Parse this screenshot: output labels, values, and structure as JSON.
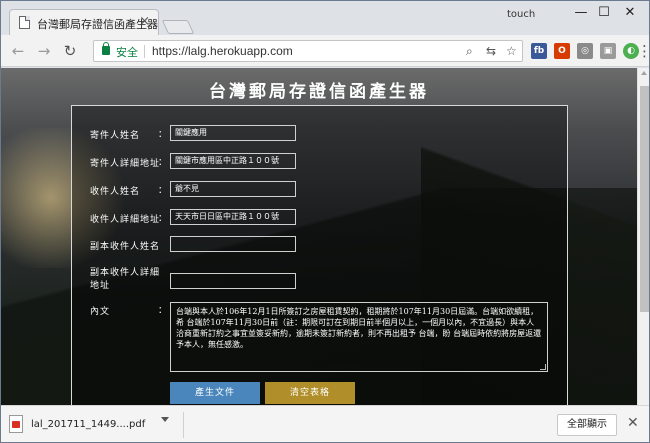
{
  "browser": {
    "tab_title": "台灣郵局存證信函產生器",
    "tab_close": "×",
    "profile_label": "touch",
    "window_controls": {
      "minimize": "—",
      "maximize": "☐",
      "close": "✕"
    },
    "nav": {
      "back": "←",
      "forward": "→",
      "reload": "↻"
    },
    "secure_label": "安全",
    "url": "https://lalg.herokuapp.com",
    "extensions": [
      {
        "name": "facebook",
        "label": "fb",
        "color": "#3b5998"
      },
      {
        "name": "office",
        "label": "O",
        "color": "#d83b01"
      },
      {
        "name": "capture",
        "label": "◎",
        "color": "#8a8a8a"
      },
      {
        "name": "screenshot",
        "label": "▣",
        "color": "#9a9a9a"
      },
      {
        "name": "chrome-ext",
        "label": "◐",
        "color": "#4caf50"
      }
    ],
    "menu": "⋮"
  },
  "page": {
    "title": "台灣郵局存證信函產生器",
    "fields": [
      {
        "label": "寄件人姓名",
        "value": "關鍵應用"
      },
      {
        "label": "寄件人詳細地址",
        "value": "關鍵市應用區中正路１００號"
      },
      {
        "label": "收件人姓名",
        "value": "爺不見"
      },
      {
        "label": "收件人詳細地址",
        "value": "天天市日日區中正路１００號"
      },
      {
        "label": "副本收件人姓名",
        "value": ""
      },
      {
        "label_line1": "副本收件人詳細",
        "label_line2": "地址",
        "value": ""
      }
    ],
    "content_label": "內文",
    "colon": "：",
    "content_text": "台端與本人於106年12月1日所簽訂之房屋租賃契約，租期將於107年11月30日屆滿。台端如欲續租，希 台端於107年11月30日前（註：期限可訂在到期日前半個月以上，一個月以內，不宜過長）與本人洽商重新訂約之事宜並簽妥新約，逾期未簽訂新約者，則不再出租予 台端，盼 台端屆時依約將房屋返還予本人，無任感激。",
    "generate_button": "產生文件",
    "clear_button": "清空表格"
  },
  "downloads": {
    "file_name": "lal_201711_1449....pdf",
    "show_all": "全部顯示",
    "close": "✕"
  }
}
